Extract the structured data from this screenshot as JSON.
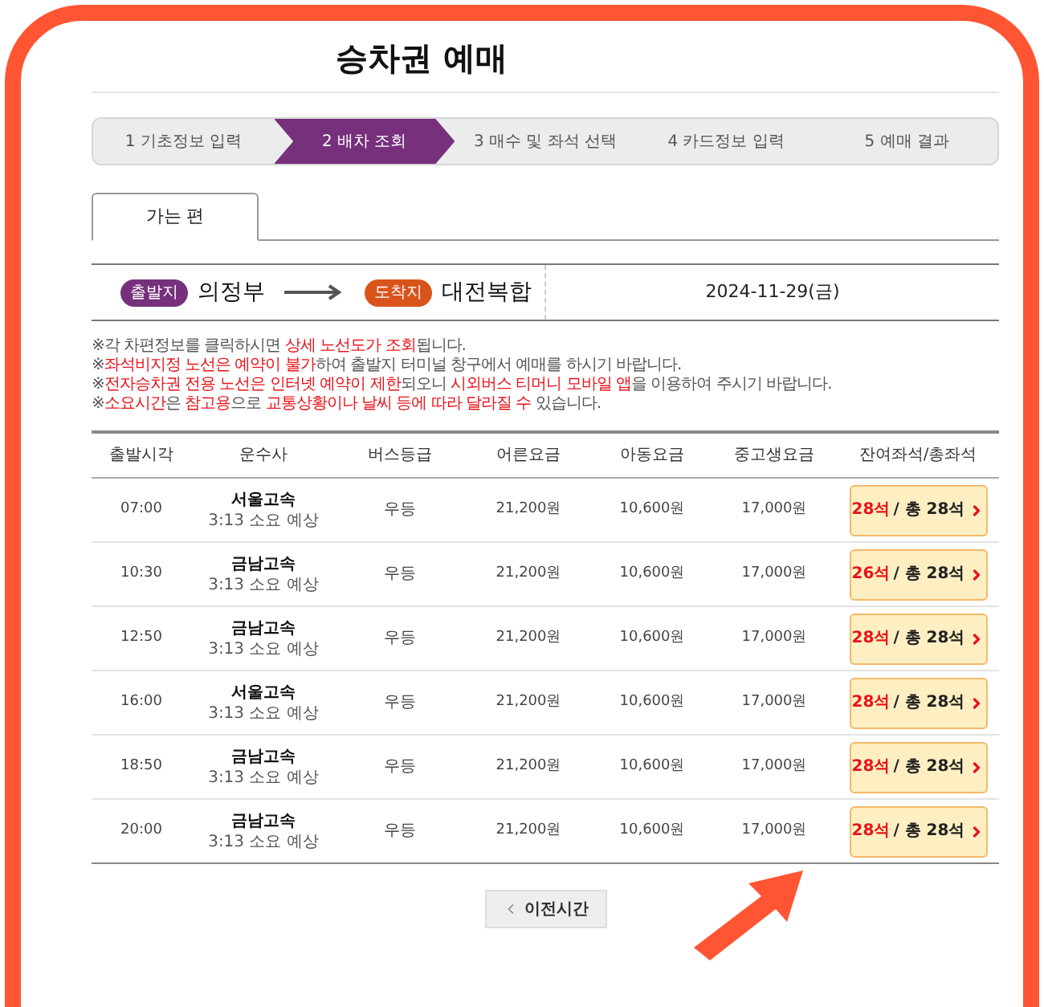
{
  "page_title": "승차권 예매",
  "steps": [
    {
      "label": "1 기초정보 입력",
      "selected": false
    },
    {
      "label": "2 배차 조회",
      "selected": true
    },
    {
      "label": "3 매수 및 좌석 선택",
      "selected": false
    },
    {
      "label": "4 카드정보 입력",
      "selected": false
    },
    {
      "label": "5 예매 결과",
      "selected": false
    }
  ],
  "tabs": [
    {
      "label": "가는 편",
      "selected": true
    }
  ],
  "route": {
    "departure_badge": "출발지",
    "departure": "의정부",
    "arrival_badge": "도착지",
    "arrival": "대전복합",
    "date": "2024-11-29(금)"
  },
  "notes": [
    {
      "segments": [
        {
          "text": "※각 차편정보를 클릭하시면 ",
          "highlight": false
        },
        {
          "text": "상세 노선도가 조회",
          "highlight": true
        },
        {
          "text": "됩니다.",
          "highlight": false
        }
      ]
    },
    {
      "segments": [
        {
          "text": "※",
          "highlight": false
        },
        {
          "text": "좌석비지정 노선은 예약이 불가",
          "highlight": true
        },
        {
          "text": "하여 출발지 터미널 창구에서 예매를 하시기 바랍니다.",
          "highlight": false
        }
      ]
    },
    {
      "segments": [
        {
          "text": "※",
          "highlight": false
        },
        {
          "text": "전자승차권 전용 노선은 인터넷 예약이 제한",
          "highlight": true
        },
        {
          "text": "되오니 ",
          "highlight": false
        },
        {
          "text": "시외버스 티머니 모바일 앱",
          "highlight": true
        },
        {
          "text": "을 이용하여 주시기 바랍니다.",
          "highlight": false
        }
      ]
    },
    {
      "segments": [
        {
          "text": "※",
          "highlight": false
        },
        {
          "text": "소요시간",
          "highlight": true
        },
        {
          "text": "은 ",
          "highlight": false
        },
        {
          "text": "참고용",
          "highlight": true
        },
        {
          "text": "으로 ",
          "highlight": false
        },
        {
          "text": "교통상황이나 날씨 등에 따라 달라질 수",
          "highlight": true
        },
        {
          "text": " 있습니다.",
          "highlight": false
        }
      ]
    }
  ],
  "table": {
    "columns": [
      "출발시각",
      "운수사",
      "버스등급",
      "어른요금",
      "아동요금",
      "중고생요금",
      "잔여좌석/총좌석"
    ],
    "rows": [
      {
        "departure_time": "07:00",
        "company": "서울고속",
        "duration": "3:13 소요 예상",
        "grade": "우등",
        "adult_fare": "21,200원",
        "child_fare": "10,600원",
        "student_fare": "17,000원",
        "seats_remaining": "28석",
        "seats_total": "/ 총 28석"
      },
      {
        "departure_time": "10:30",
        "company": "금남고속",
        "duration": "3:13 소요 예상",
        "grade": "우등",
        "adult_fare": "21,200원",
        "child_fare": "10,600원",
        "student_fare": "17,000원",
        "seats_remaining": "26석",
        "seats_total": "/ 총 28석"
      },
      {
        "departure_time": "12:50",
        "company": "금남고속",
        "duration": "3:13 소요 예상",
        "grade": "우등",
        "adult_fare": "21,200원",
        "child_fare": "10,600원",
        "student_fare": "17,000원",
        "seats_remaining": "28석",
        "seats_total": "/ 총 28석"
      },
      {
        "departure_time": "16:00",
        "company": "서울고속",
        "duration": "3:13 소요 예상",
        "grade": "우등",
        "adult_fare": "21,200원",
        "child_fare": "10,600원",
        "student_fare": "17,000원",
        "seats_remaining": "28석",
        "seats_total": "/ 총 28석"
      },
      {
        "departure_time": "18:50",
        "company": "금남고속",
        "duration": "3:13 소요 예상",
        "grade": "우등",
        "adult_fare": "21,200원",
        "child_fare": "10,600원",
        "student_fare": "17,000원",
        "seats_remaining": "28석",
        "seats_total": "/ 총 28석"
      },
      {
        "departure_time": "20:00",
        "company": "금남고속",
        "duration": "3:13 소요 예상",
        "grade": "우등",
        "adult_fare": "21,200원",
        "child_fare": "10,600원",
        "student_fare": "17,000원",
        "seats_remaining": "28석",
        "seats_total": "/ 총 28석"
      }
    ]
  },
  "prev_button": "이전시간"
}
